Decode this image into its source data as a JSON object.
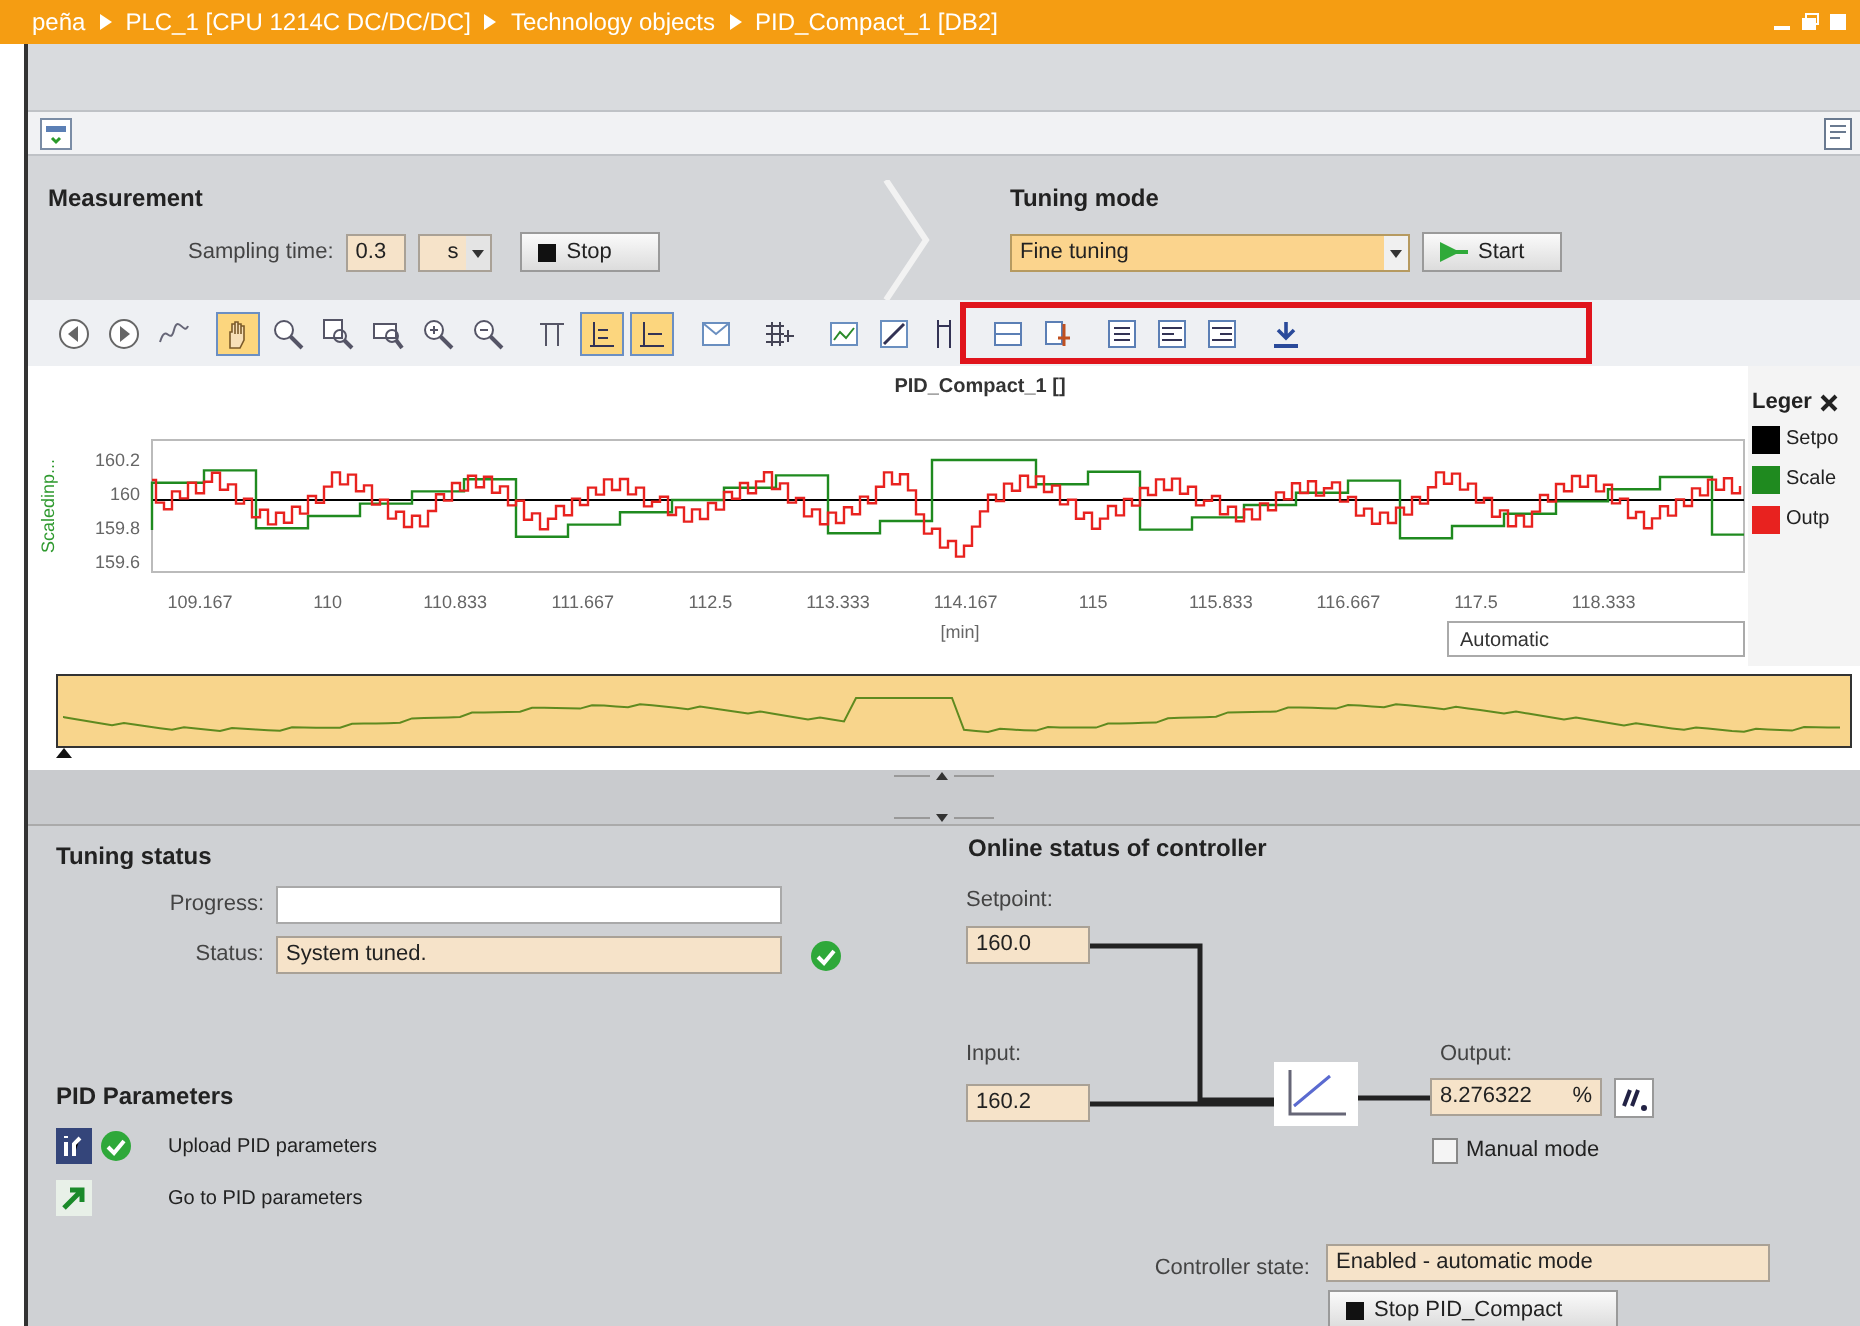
{
  "breadcrumb": [
    {
      "label": "peña"
    },
    {
      "label": "PLC_1 [CPU 1214C DC/DC/DC]"
    },
    {
      "label": "Technology objects"
    },
    {
      "label": "PID_Compact_1 [DB2]"
    }
  ],
  "measurement": {
    "title": "Measurement",
    "sampling_label": "Sampling time:",
    "sampling_value": "0.3",
    "sampling_unit": "s",
    "stop_button": "Stop"
  },
  "tuning_mode": {
    "title": "Tuning mode",
    "mode": "Fine tuning",
    "start_button": "Start"
  },
  "chart_tools": [
    {
      "selected": false
    },
    {
      "selected": false
    },
    {
      "selected": false
    },
    {
      "selected": true
    },
    {
      "selected": false
    },
    {
      "selected": false
    },
    {
      "selected": false
    },
    {
      "selected": false
    },
    {
      "selected": false
    },
    {
      "selected": false
    },
    {
      "selected": true
    },
    {
      "selected": true
    },
    {
      "selected": false
    },
    {
      "selected": false
    },
    {
      "selected": false
    },
    {
      "selected": false
    },
    {
      "selected": false
    },
    {
      "selected": false
    },
    {
      "selected": false
    },
    {
      "selected": false
    },
    {
      "selected": false
    },
    {
      "selected": false
    },
    {
      "selected": false
    }
  ],
  "trend": {
    "title": "PID_Compact_1 []",
    "y_label": "Scaledinp...",
    "y_ticks": [
      "160.2",
      "160",
      "159.8",
      "159.6"
    ],
    "x_ticks": [
      "109.167",
      "110",
      "110.833",
      "111.667",
      "112.5",
      "113.333",
      "114.167",
      "115",
      "115.833",
      "116.667",
      "117.5",
      "118.333"
    ],
    "x_label": "[min]",
    "view_mode": "Automatic"
  },
  "legend": {
    "title": "Leger",
    "items": [
      {
        "label": "Setpo",
        "color": "#000000"
      },
      {
        "label": "Scale",
        "color": "#1f8a1f"
      },
      {
        "label": "Outp",
        "color": "#e8221f"
      }
    ]
  },
  "tuning_status": {
    "title": "Tuning status",
    "progress_label": "Progress:",
    "status_label": "Status:",
    "status_value": "System tuned.",
    "status_ok": true
  },
  "pid_parameters": {
    "title": "PID Parameters",
    "actions": [
      {
        "kind": "upload",
        "label": "Upload PID parameters",
        "done": true
      },
      {
        "kind": "goto",
        "label": "Go to PID parameters",
        "done": false
      }
    ]
  },
  "online_status": {
    "title": "Online status of controller",
    "setpoint_label": "Setpoint:",
    "setpoint": "160.0",
    "input_label": "Input:",
    "input": "160.2",
    "output_label": "Output:",
    "output": "8.276322",
    "output_unit": "%",
    "manual_mode": {
      "label": "Manual mode",
      "checked": false
    },
    "controller_state_label": "Controller state:",
    "controller_state": "Enabled - automatic mode",
    "stop_button": "Stop PID_Compact"
  }
}
